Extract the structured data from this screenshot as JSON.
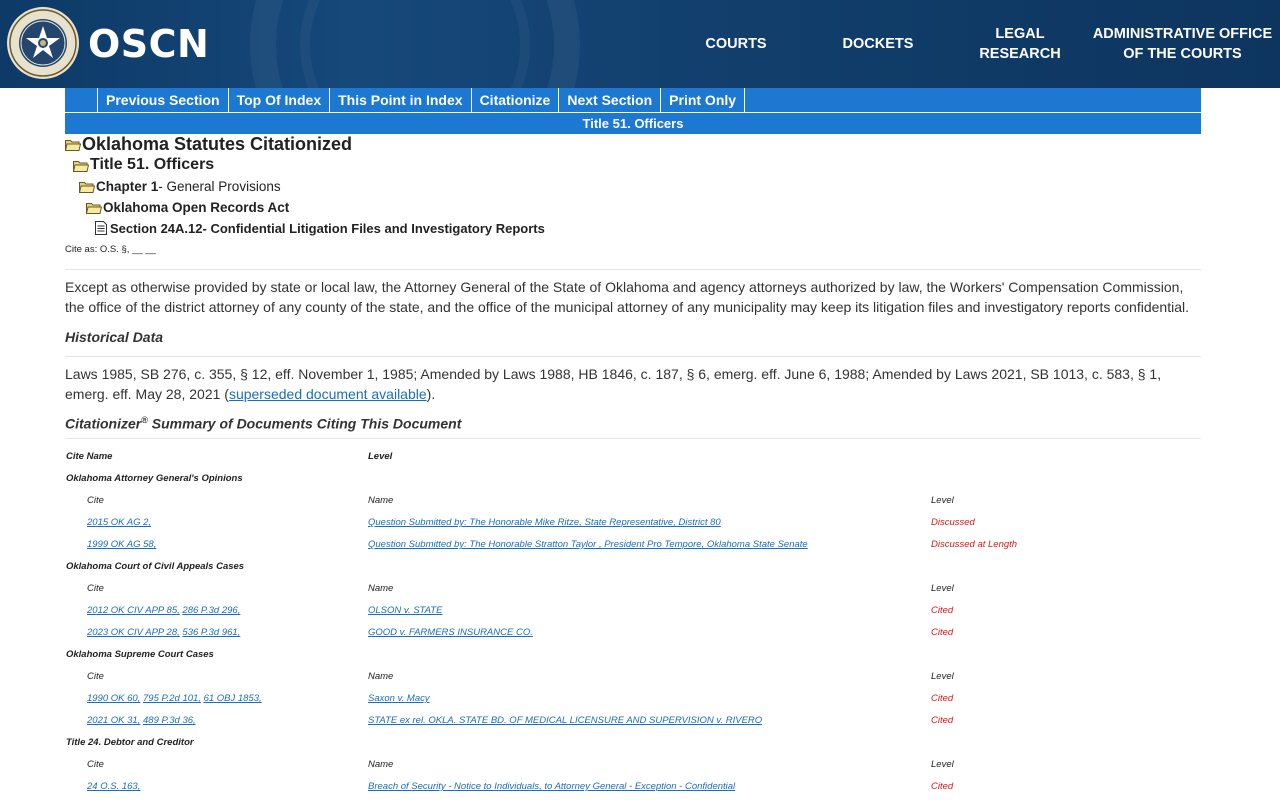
{
  "header": {
    "logo_text": "OSCN",
    "nav": [
      "COURTS",
      "DOCKETS",
      "LEGAL",
      "RESEARCH",
      "ADMINISTRATIVE OFFICE",
      "OF THE COURTS"
    ]
  },
  "toolbar": {
    "buttons": [
      "Previous Section",
      "Top Of Index",
      "This Point in Index",
      "Citationize",
      "Next Section",
      "Print Only"
    ],
    "title": "Title 51. Officers"
  },
  "breadcrumb": {
    "l1": "Oklahoma Statutes Citationized",
    "l2": "Title 51. Officers",
    "l3_a": "Chapter 1",
    "l3_b": " - General Provisions",
    "l4": "Oklahoma Open Records Act",
    "l5_a": "Section 24A.12",
    "l5_b": " - Confidential Litigation Files and Investigatory Reports"
  },
  "cite_as": "Cite as: O.S. §, __ __",
  "body": {
    "paragraph": "Except as otherwise provided by state or local law, the Attorney General of the State of Oklahoma and agency attorneys authorized by law, the Workers' Compensation Commission, the office of the district attorney of any county of the state, and the office of the municipal attorney of any municipality may keep its litigation files and investigatory reports confidential.",
    "historical_heading": "Historical Data",
    "historical_text": "Laws 1985, SB 276, c. 355, § 12, eff. November 1, 1985; Amended by Laws 1988, HB 1846, c. 187, § 6, emerg. eff. June 6, 1988; Amended by Laws 2021, SB 1013, c. 583, § 1, emerg. eff. May 28, 2021 (",
    "historical_link": "superseded document available",
    "historical_end": ").",
    "citationizer_heading_a": "Citationizer",
    "citationizer_heading_sup": "®",
    "citationizer_heading_b": " Summary of Documents Citing This Document"
  },
  "table": {
    "header": {
      "cite_name": "Cite Name",
      "level": "Level"
    },
    "sub_header": {
      "cite": "Cite",
      "name": "Name",
      "level": "Level"
    },
    "groups": [
      {
        "title": "Oklahoma Attorney General's Opinions",
        "rows": [
          {
            "cite": "2015 OK AG 2,",
            "name": "Question Submitted by: The Honorable Mike Ritze, State Representative, District 80",
            "level": "Discussed"
          },
          {
            "cite": "1999 OK AG 58,",
            "name": "Question Submitted by: The Honorable Stratton Taylor , President Pro Tempore, Oklahoma State Senate",
            "level": "Discussed at Length"
          }
        ]
      },
      {
        "title": "Oklahoma Court of Civil Appeals Cases",
        "rows": [
          {
            "cite": "2012 OK CIV APP 85,",
            "cite2": "286 P.3d 296,",
            "name": "OLSON v. STATE",
            "level": "Cited"
          },
          {
            "cite": "2023 OK CIV APP 28,",
            "cite2": "536 P.3d 961,",
            "name": "GOOD v. FARMERS INSURANCE CO.",
            "level": "Cited"
          }
        ]
      },
      {
        "title": "Oklahoma Supreme Court Cases",
        "rows": [
          {
            "cite": "1990 OK 60,",
            "cite2": "795 P.2d 101,",
            "cite3": "61 OBJ 1853,",
            "name": "Saxon v. Macy",
            "level": "Cited"
          },
          {
            "cite": "2021 OK 31,",
            "cite2": "489 P.3d 36,",
            "name": "STATE ex rel. OKLA. STATE BD. OF MEDICAL LICENSURE AND SUPERVISION v. RIVERO",
            "level": "Cited"
          }
        ]
      },
      {
        "title": "Title 24. Debtor and Creditor",
        "rows": [
          {
            "cite": "24 O.S. 163,",
            "name": "Breach of Security - Notice to Individuals, to Attorney General - Exception - Confidential",
            "level": "Cited"
          }
        ]
      }
    ]
  },
  "colors": {
    "header_bg": "#123f6d",
    "toolbar_bg": "#1c78d0",
    "link": "#1a6fb8",
    "level": "#d31a1a"
  }
}
